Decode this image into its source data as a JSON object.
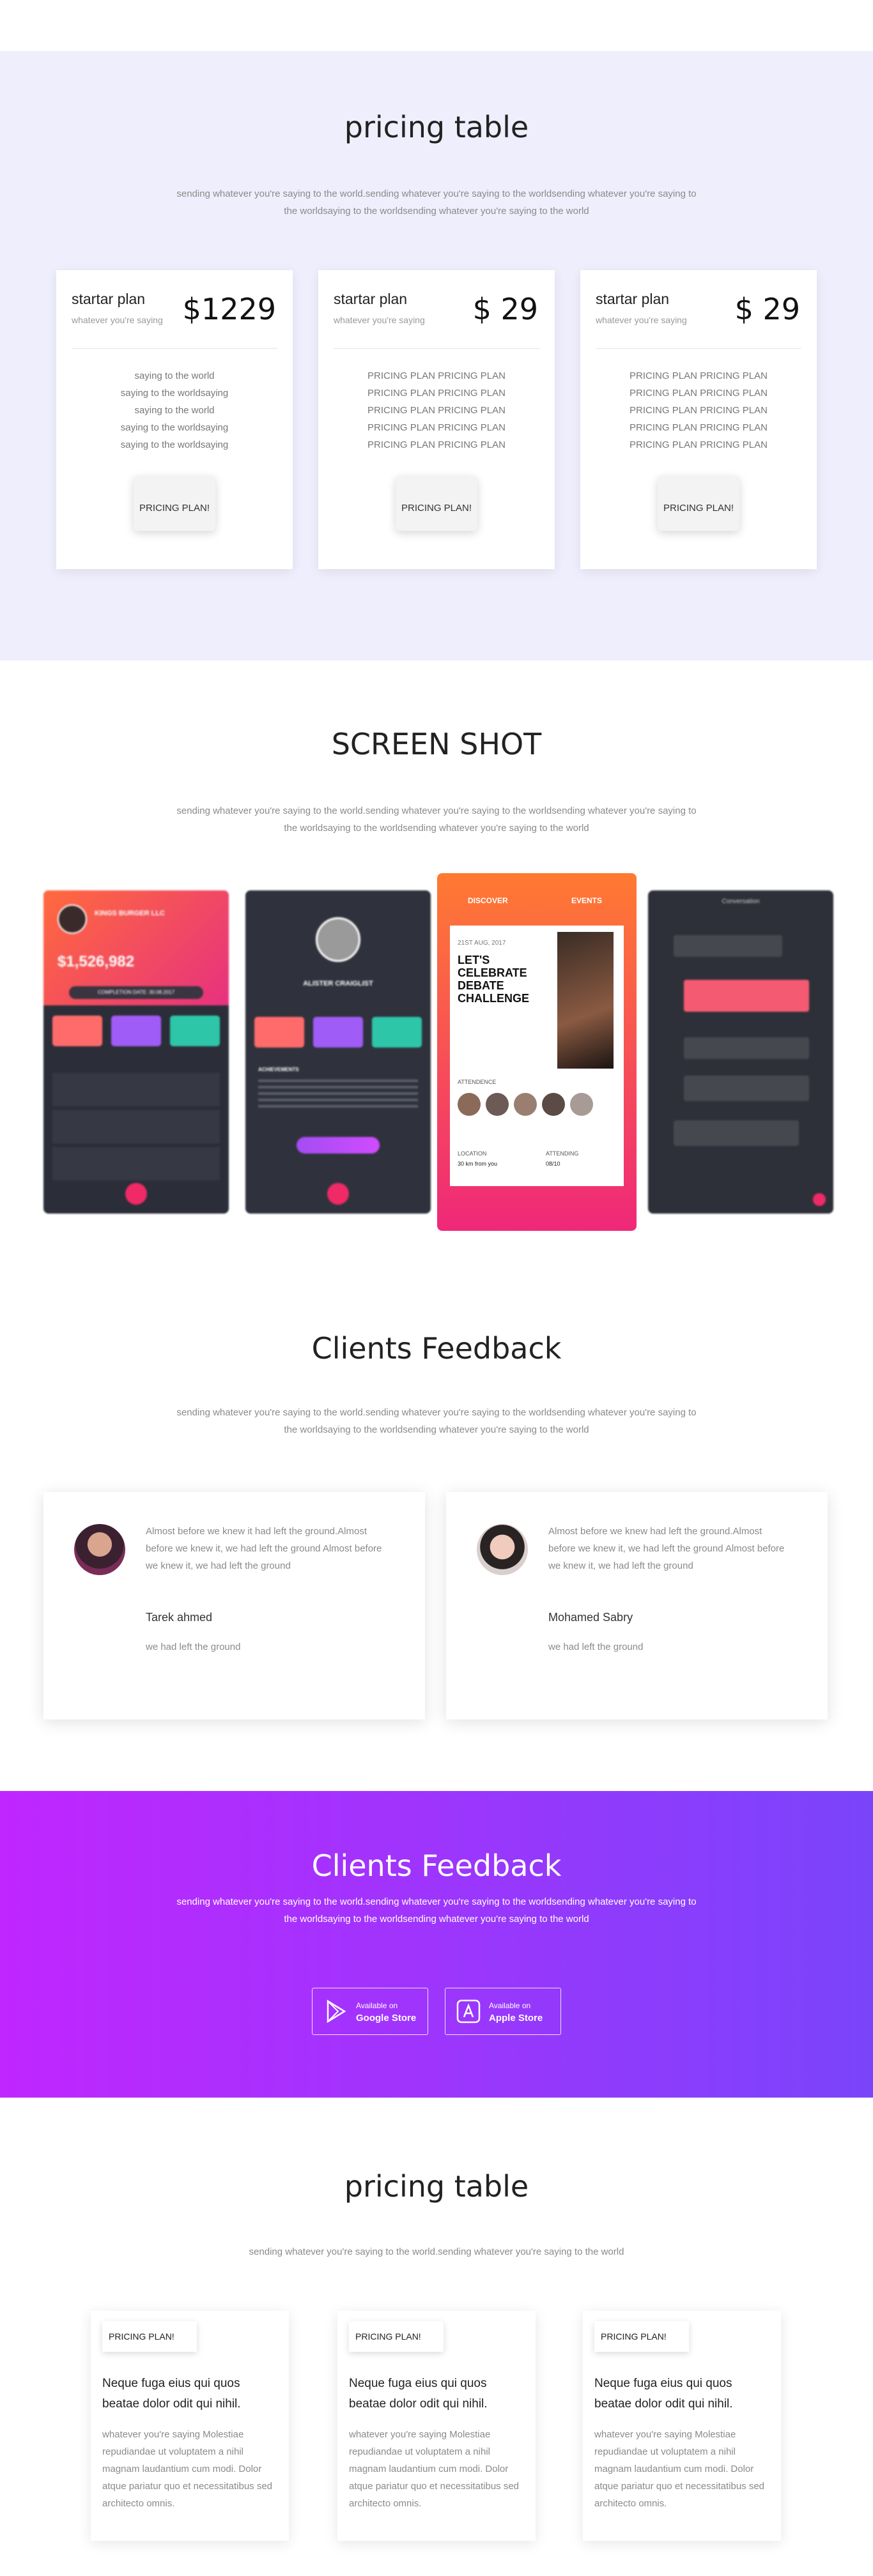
{
  "pricing": {
    "title": "pricing table",
    "subtitle": "sending whatever you're saying to the world.sending whatever you're saying to the worldsending whatever you're saying to the worldsaying to the worldsending whatever you're saying to the world",
    "cards": [
      {
        "plan": "startar plan",
        "desc": "whatever you're saying",
        "price": "$1229",
        "features": [
          "saying to the world",
          "saying to the worldsaying",
          "saying to the world",
          "saying to the worldsaying",
          "saying to the worldsaying"
        ],
        "button": "PRICING PLAN!"
      },
      {
        "plan": "startar plan",
        "desc": "whatever you're saying",
        "price": "$ 29",
        "features": [
          "PRICING PLAN PRICING PLAN",
          "PRICING PLAN PRICING PLAN",
          "PRICING PLAN PRICING PLAN",
          "PRICING PLAN PRICING PLAN",
          "PRICING PLAN PRICING PLAN"
        ],
        "button": "PRICING PLAN!"
      },
      {
        "plan": "startar plan",
        "desc": "whatever you're saying",
        "price": "$ 29",
        "features": [
          "PRICING PLAN PRICING PLAN",
          "PRICING PLAN PRICING PLAN",
          "PRICING PLAN PRICING PLAN",
          "PRICING PLAN PRICING PLAN",
          "PRICING PLAN PRICING PLAN"
        ],
        "button": "PRICING PLAN!"
      }
    ]
  },
  "screenshots": {
    "title": "SCREEN SHOT",
    "subtitle": "sending whatever you're saying to the world.sending whatever you're saying to the worldsending whatever you're saying to the worldsaying to the worldsending whatever you're saying to the world",
    "phone1": {
      "company": "KINGS BURGER LLC",
      "amount": "$1,526,982",
      "completion": "COMPLETION DATE: 30.08.2017"
    },
    "phone2": {
      "name": "ALISTER CRAIGLIST",
      "section": "ACHIEVEMENTS"
    },
    "phone3": {
      "tab_discover": "DISCOVER",
      "tab_events": "EVENTS",
      "date": "21ST AUG, 2017",
      "headline": "LET'S CELEBRATE DEBATE CHALLENGE",
      "attendence": "ATTENDENCE",
      "location_label": "LOCATION",
      "location_value": "30 km from you",
      "attending_label": "ATTENDING",
      "attending_value": "08/10"
    },
    "phone4": {
      "header": "Conversation"
    }
  },
  "feedback": {
    "title": "Clients Feedback",
    "subtitle": "sending whatever you're saying to the world.sending whatever you're saying to the worldsending whatever you're saying to the worldsaying to the worldsending whatever you're saying to the world",
    "items": [
      {
        "quote": "Almost before we knew it had left the ground.Almost before we knew it, we had left the ground Almost before we knew it, we had left the ground",
        "name": "Tarek ahmed",
        "role": "we had left the ground"
      },
      {
        "quote": "Almost before we knew had left the ground.Almost before we knew it, we had left the ground Almost before we knew it, we had left the ground",
        "name": "Mohamed Sabry",
        "role": "we had left the ground"
      }
    ]
  },
  "download": {
    "title": "Clients Feedback",
    "subtitle": "sending whatever you're saying to the world.sending whatever you're saying to the worldsending whatever you're saying to the worldsaying to the worldsending whatever you're saying to the world",
    "google": {
      "line1": "Available on",
      "line2": "Google Store"
    },
    "apple": {
      "line1": "Available on",
      "line2": "Apple Store"
    }
  },
  "pricing2": {
    "title": "pricing table",
    "subtitle": "sending whatever you're saying to the world.sending whatever you're saying to the world",
    "cards": [
      {
        "tag": "PRICING PLAN!",
        "title": "Neque fuga eius qui quos beatae dolor odit qui nihil.",
        "body": "whatever you're saying Molestiae repudiandae ut voluptatem a nihil magnam laudantium cum modi. Dolor atque pariatur quo et necessitatibus sed architecto omnis."
      },
      {
        "tag": "PRICING PLAN!",
        "title": "Neque fuga eius qui quos beatae dolor odit qui nihil.",
        "body": "whatever you're saying Molestiae repudiandae ut voluptatem a nihil magnam laudantium cum modi. Dolor atque pariatur quo et necessitatibus sed architecto omnis."
      },
      {
        "tag": "PRICING PLAN!",
        "title": "Neque fuga eius qui quos beatae dolor odit qui nihil.",
        "body": "whatever you're saying Molestiae repudiandae ut voluptatem a nihil magnam laudantium cum modi. Dolor atque pariatur quo et necessitatibus sed architecto omnis."
      }
    ]
  },
  "colors": {
    "accent_purple": "#c026ff",
    "accent_violet": "#7a44fb",
    "pricing_bg": "#efeefc"
  }
}
